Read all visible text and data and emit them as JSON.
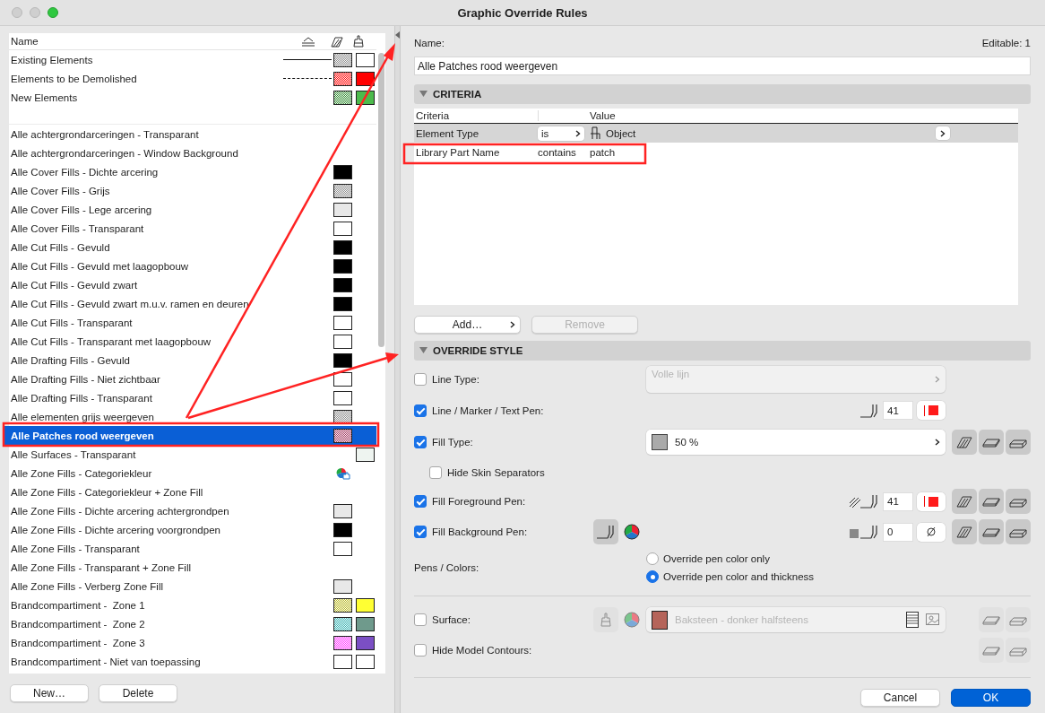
{
  "window": {
    "title": "Graphic Override Rules"
  },
  "rule_list": {
    "name_column": "Name",
    "phase_rows": [
      {
        "name": "Existing Elements",
        "line": {
          "kind": "solid"
        },
        "fill": {
          "kind": "hatch",
          "color": "#8a8a8a"
        },
        "surface": {
          "kind": "solid",
          "color": "#ffffff"
        }
      },
      {
        "name": "Elements to be Demolished",
        "line": {
          "kind": "dashed"
        },
        "fill": {
          "kind": "hatch",
          "color": "#ff0000"
        },
        "surface": {
          "kind": "solid",
          "color": "#ff0000"
        }
      },
      {
        "name": "New Elements",
        "fill": {
          "kind": "hatch",
          "color": "#2e8b2e"
        },
        "surface": {
          "kind": "solid",
          "color": "#4cbb4c"
        }
      }
    ],
    "rows": [
      {
        "name": "Alle achtergrondarceringen - Transparant",
        "selected": false
      },
      {
        "name": "Alle achtergrondarceringen - Window Background",
        "selected": false
      },
      {
        "name": "Alle Cover Fills - Dichte arcering",
        "selected": false,
        "fill": {
          "kind": "solid",
          "color": "#000000"
        }
      },
      {
        "name": "Alle Cover Fills - Grijs",
        "selected": false,
        "fill": {
          "kind": "hatch",
          "color": "#8a8a8a"
        }
      },
      {
        "name": "Alle Cover Fills - Lege arcering",
        "selected": false,
        "fill": {
          "kind": "solid",
          "color": "#e8e8e8"
        }
      },
      {
        "name": "Alle Cover Fills - Transparant",
        "selected": false,
        "fill": {
          "kind": "solid",
          "color": "#ffffff"
        }
      },
      {
        "name": "Alle Cut Fills - Gevuld",
        "selected": false,
        "fill": {
          "kind": "solid",
          "color": "#000000"
        }
      },
      {
        "name": "Alle Cut Fills - Gevuld met laagopbouw",
        "selected": false,
        "fill": {
          "kind": "solid",
          "color": "#000000"
        }
      },
      {
        "name": "Alle Cut Fills - Gevuld zwart",
        "selected": false,
        "fill": {
          "kind": "solid",
          "color": "#000000"
        }
      },
      {
        "name": "Alle Cut Fills - Gevuld zwart m.u.v. ramen en deuren",
        "selected": false,
        "fill": {
          "kind": "solid",
          "color": "#000000"
        }
      },
      {
        "name": "Alle Cut Fills - Transparant",
        "selected": false,
        "fill": {
          "kind": "solid",
          "color": "#ffffff"
        }
      },
      {
        "name": "Alle Cut Fills - Transparant met laagopbouw",
        "selected": false,
        "fill": {
          "kind": "solid",
          "color": "#ffffff"
        }
      },
      {
        "name": "Alle Drafting Fills - Gevuld",
        "selected": false,
        "fill": {
          "kind": "solid",
          "color": "#000000"
        }
      },
      {
        "name": "Alle Drafting Fills - Niet zichtbaar",
        "selected": false,
        "fill": {
          "kind": "solid",
          "color": "#ffffff"
        }
      },
      {
        "name": "Alle Drafting Fills - Transparant",
        "selected": false,
        "fill": {
          "kind": "solid",
          "color": "#ffffff"
        }
      },
      {
        "name": "Alle elementen grijs weergeven",
        "selected": false,
        "fill": {
          "kind": "hatch",
          "color": "#8a8a8a"
        }
      },
      {
        "name": "Alle Patches rood weergeven",
        "selected": true,
        "fill": {
          "kind": "hatch",
          "color": "#a0305a"
        }
      },
      {
        "name": "Alle Surfaces - Transparant",
        "selected": false,
        "surface": {
          "kind": "solid",
          "color": "#eef4f0"
        }
      },
      {
        "name": "Alle Zone Fills - Categoriekleur",
        "selected": false,
        "fill": {
          "kind": "category"
        }
      },
      {
        "name": "Alle Zone Fills - Categoriekleur + Zone Fill",
        "selected": false
      },
      {
        "name": "Alle Zone Fills - Dichte arcering achtergrondpen",
        "selected": false,
        "fill": {
          "kind": "solid",
          "color": "#e8e8e8"
        }
      },
      {
        "name": "Alle Zone Fills - Dichte arcering voorgrondpen",
        "selected": false,
        "fill": {
          "kind": "solid",
          "color": "#000000"
        }
      },
      {
        "name": "Alle Zone Fills - Transparant",
        "selected": false,
        "fill": {
          "kind": "solid",
          "color": "#ffffff"
        }
      },
      {
        "name": "Alle Zone Fills - Transparant + Zone Fill",
        "selected": false
      },
      {
        "name": "Alle Zone Fills - Verberg Zone Fill",
        "selected": false,
        "fill": {
          "kind": "solid",
          "color": "#e8e8e8"
        }
      },
      {
        "name": "Brandcompartiment -  Zone 1",
        "selected": false,
        "fill": {
          "kind": "hatch",
          "color": "#b8b820"
        },
        "surface": {
          "kind": "solid",
          "color": "#ffff33"
        }
      },
      {
        "name": "Brandcompartiment -  Zone 2",
        "selected": false,
        "fill": {
          "kind": "hatch",
          "color": "#30b0b0"
        },
        "surface": {
          "kind": "solid",
          "color": "#6f9a8c"
        }
      },
      {
        "name": "Brandcompartiment -  Zone 3",
        "selected": false,
        "fill": {
          "kind": "hatch",
          "color": "#ff33ff"
        },
        "surface": {
          "kind": "solid",
          "color": "#7b4fc4"
        }
      },
      {
        "name": "Brandcompartiment - Niet van toepassing",
        "selected": false,
        "fill": {
          "kind": "solid",
          "color": "#ffffff"
        },
        "surface": {
          "kind": "solid",
          "color": "#ffffff"
        }
      }
    ]
  },
  "list_buttons": [
    "New…",
    "Delete"
  ],
  "editor": {
    "name_label": "Name:",
    "editable": "Editable: 1",
    "name_value": "Alle Patches rood weergeven",
    "criteria": {
      "title": "CRITERIA",
      "expanded": true,
      "columns": [
        "Criteria",
        "Value"
      ],
      "rows": [
        {
          "kind": "popup",
          "field": "Element Type",
          "operator": "is",
          "value": "Object",
          "selected": true
        },
        {
          "kind": "text",
          "field": "Library Part Name",
          "operator": "contains",
          "value": "patch",
          "selected": false
        }
      ],
      "add_button": "Add…",
      "remove_button": {
        "label": "Remove",
        "disabled": true
      }
    },
    "override_style": {
      "title": "OVERRIDE STYLE",
      "expanded": true,
      "line_type": {
        "label": "Line Type:",
        "checked": false,
        "value": "Volle lijn",
        "disabled": true
      },
      "line_pen": {
        "label": "Line / Marker / Text Pen:",
        "checked": true,
        "pen": "41",
        "color": "#ff1a1a"
      },
      "fill_type": {
        "label": "Fill Type:",
        "checked": true,
        "value": "50 %"
      },
      "hide_skin": {
        "label": "Hide Skin Separators",
        "checked": false
      },
      "fill_fg_pen": {
        "label": "Fill Foreground Pen:",
        "checked": true,
        "pen": "41",
        "color": "#ff1a1a"
      },
      "fill_bg_pen": {
        "label": "Fill Background Pen:",
        "checked": true,
        "pen": "0"
      },
      "pens_colors": {
        "label": "Pens / Colors:",
        "options": [
          {
            "label": "Override pen color only",
            "selected": false
          },
          {
            "label": "Override pen color and thickness",
            "selected": true
          }
        ]
      },
      "surface": {
        "label": "Surface:",
        "checked": false,
        "value": "Baksteen - donker halfsteens",
        "color": "#b5645a",
        "disabled": true
      },
      "hide_contours": {
        "label": "Hide Model Contours:",
        "checked": false
      }
    },
    "cancel": "Cancel",
    "ok": "OK"
  }
}
